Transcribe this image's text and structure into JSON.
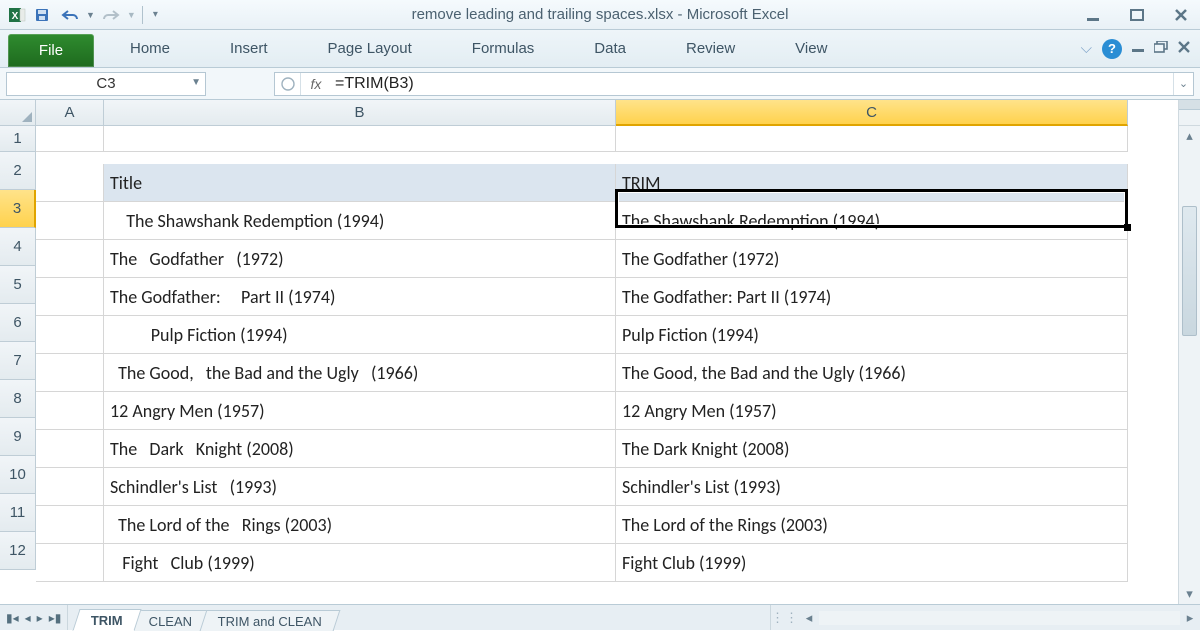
{
  "titlebar": {
    "title": "remove leading and trailing spaces.xlsx  -  Microsoft Excel"
  },
  "ribbon": {
    "file": "File",
    "tabs": [
      "Home",
      "Insert",
      "Page Layout",
      "Formulas",
      "Data",
      "Review",
      "View"
    ]
  },
  "formula_bar": {
    "name_box": "C3",
    "fx_label": "fx",
    "formula": "=TRIM(B3)"
  },
  "columns": [
    "A",
    "B",
    "C"
  ],
  "rows": [
    "1",
    "2",
    "3",
    "4",
    "5",
    "6",
    "7",
    "8",
    "9",
    "10",
    "11",
    "12"
  ],
  "selected_cell": "C3",
  "headers": {
    "B": "Title",
    "C": "TRIM"
  },
  "data": {
    "B": [
      "    The Shawshank Redemption (1994)",
      "The   Godfather   (1972)",
      "The Godfather:     Part II (1974)",
      "          Pulp Fiction (1994)",
      "  The Good,   the Bad and the Ugly   (1966)",
      "12 Angry Men (1957)",
      "The   Dark   Knight (2008)",
      "Schindler's List   (1993)",
      "  The Lord of the   Rings (2003)",
      "   Fight   Club (1999)"
    ],
    "C": [
      "The Shawshank Redemption (1994)",
      "The Godfather (1972)",
      "The Godfather: Part II (1974)",
      "Pulp Fiction (1994)",
      "The Good, the Bad and the Ugly (1966)",
      "12 Angry Men (1957)",
      "The Dark Knight (2008)",
      "Schindler's List (1993)",
      "The Lord of the Rings (2003)",
      "Fight Club (1999)"
    ]
  },
  "sheet_tabs": {
    "active": "TRIM",
    "others": [
      "CLEAN",
      "TRIM and CLEAN"
    ]
  }
}
